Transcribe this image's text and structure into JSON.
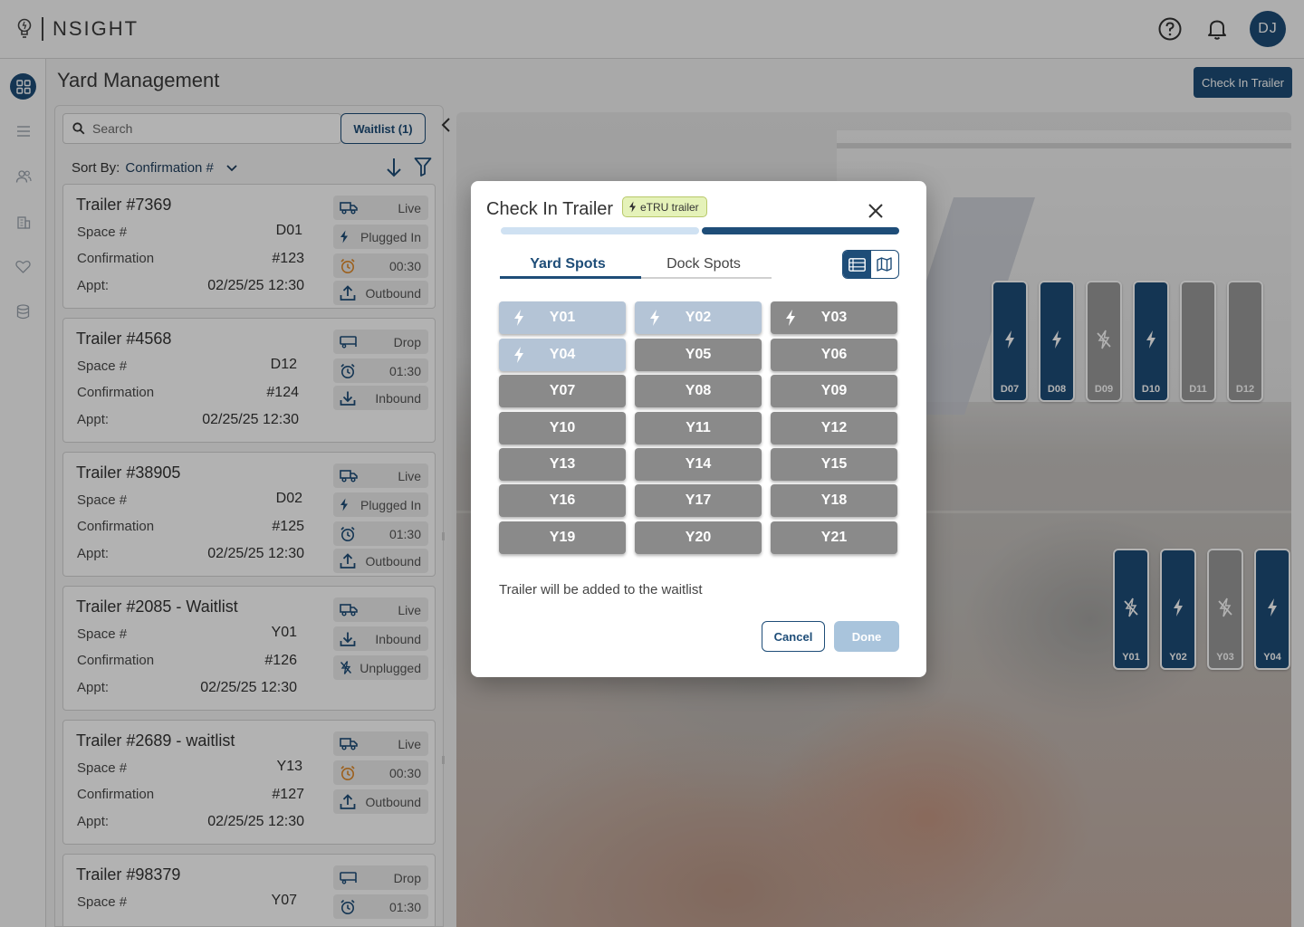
{
  "app": {
    "logo_text": "NSIGHT",
    "user_initials": "DJ"
  },
  "colors": {
    "brand": "#1e4d78",
    "spot_grey": "#8a8a8a",
    "spot_powered_light": "#b4c4d6",
    "etru_badge": "#e5f2b9",
    "timer_orange": "#e08a2a"
  },
  "header": {
    "title": "Yard Management",
    "check_in_label": "Check In Trailer"
  },
  "sidebar": {
    "items": [
      {
        "icon": "dashboard-grid-icon",
        "active": true
      },
      {
        "icon": "list-icon",
        "active": false
      },
      {
        "icon": "users-icon",
        "active": false
      },
      {
        "icon": "building-icon",
        "active": false
      },
      {
        "icon": "heart-icon",
        "active": false
      },
      {
        "icon": "database-icon",
        "active": false
      }
    ]
  },
  "list_panel": {
    "search_placeholder": "Search",
    "waitlist_label": "Waitlist (1)",
    "sort_label": "Sort By:",
    "sort_value": "Confirmation #",
    "labels": {
      "space": "Space #",
      "confirmation": "Confirmation",
      "appt": "Appt:"
    },
    "trailers": [
      {
        "title": "Trailer #7369",
        "space": "D01",
        "confirmation": "#123",
        "appt": "02/25/25 12:30",
        "chips": [
          {
            "icon": "truck-icon",
            "text": "Live"
          },
          {
            "icon": "bolt-icon",
            "text": "Plugged In"
          },
          {
            "icon": "alarm-clock-icon",
            "text": "00:30",
            "alert": true
          },
          {
            "icon": "upload-icon",
            "text": "Outbound"
          }
        ]
      },
      {
        "title": "Trailer #4568",
        "space": "D12",
        "confirmation": "#124",
        "appt": "02/25/25 12:30",
        "chips": [
          {
            "icon": "trailer-icon",
            "text": "Drop"
          },
          {
            "icon": "alarm-clock-icon",
            "text": "01:30"
          },
          {
            "icon": "download-icon",
            "text": "Inbound"
          }
        ]
      },
      {
        "title": "Trailer #38905",
        "space": "D02",
        "confirmation": "#125",
        "appt": "02/25/25 12:30",
        "chips": [
          {
            "icon": "truck-icon",
            "text": "Live"
          },
          {
            "icon": "bolt-icon",
            "text": "Plugged In"
          },
          {
            "icon": "alarm-clock-icon",
            "text": "01:30"
          },
          {
            "icon": "upload-icon",
            "text": "Outbound"
          }
        ]
      },
      {
        "title": "Trailer #2085 - Waitlist",
        "space": "Y01",
        "confirmation": "#126",
        "appt": "02/25/25 12:30",
        "chips": [
          {
            "icon": "truck-icon",
            "text": "Live"
          },
          {
            "icon": "download-icon",
            "text": "Inbound"
          },
          {
            "icon": "bolt-off-icon",
            "text": "Unplugged"
          }
        ]
      },
      {
        "title": "Trailer #2689 - waitlist",
        "space": "Y13",
        "confirmation": "#127",
        "appt": "02/25/25 12:30",
        "chips": [
          {
            "icon": "truck-icon",
            "text": "Live"
          },
          {
            "icon": "alarm-clock-icon",
            "text": "00:30",
            "alert": true
          },
          {
            "icon": "upload-icon",
            "text": "Outbound"
          }
        ]
      },
      {
        "title": "Trailer #98379",
        "space": "Y07",
        "confirmation": "",
        "appt": "",
        "chips": [
          {
            "icon": "trailer-icon",
            "text": "Drop"
          },
          {
            "icon": "alarm-clock-icon",
            "text": "01:30"
          }
        ]
      }
    ]
  },
  "map": {
    "dock_spots": [
      {
        "label": "D07",
        "status": "powered",
        "color": "blue"
      },
      {
        "label": "D08",
        "status": "powered",
        "color": "blue"
      },
      {
        "label": "D09",
        "status": "unpowered",
        "color": "grey"
      },
      {
        "label": "D10",
        "status": "powered",
        "color": "blue"
      },
      {
        "label": "D11",
        "status": "none",
        "color": "grey"
      },
      {
        "label": "D12",
        "status": "none",
        "color": "grey"
      }
    ],
    "yard_spots": [
      {
        "label": "Y01",
        "status": "unpowered",
        "color": "blue"
      },
      {
        "label": "Y02",
        "status": "powered",
        "color": "blue"
      },
      {
        "label": "Y03",
        "status": "unpowered",
        "color": "grey"
      },
      {
        "label": "Y04",
        "status": "powered",
        "color": "blue"
      }
    ]
  },
  "modal": {
    "title": "Check In Trailer",
    "badge": "eTRU trailer",
    "tabs": [
      "Yard Spots",
      "Dock Spots"
    ],
    "active_tab": "Yard Spots",
    "spots": [
      {
        "label": "Y01",
        "powered": true,
        "style": "light"
      },
      {
        "label": "Y02",
        "powered": true,
        "style": "light"
      },
      {
        "label": "Y03",
        "powered": true,
        "style": "grey"
      },
      {
        "label": "Y04",
        "powered": true,
        "style": "light"
      },
      {
        "label": "Y05"
      },
      {
        "label": "Y06"
      },
      {
        "label": "Y07"
      },
      {
        "label": "Y08"
      },
      {
        "label": "Y09"
      },
      {
        "label": "Y10"
      },
      {
        "label": "Y11"
      },
      {
        "label": "Y12"
      },
      {
        "label": "Y13"
      },
      {
        "label": "Y14"
      },
      {
        "label": "Y15"
      },
      {
        "label": "Y16"
      },
      {
        "label": "Y17"
      },
      {
        "label": "Y18"
      },
      {
        "label": "Y19"
      },
      {
        "label": "Y20"
      },
      {
        "label": "Y21"
      }
    ],
    "note": "Trailer will be added to the waitlist",
    "cancel_label": "Cancel",
    "done_label": "Done"
  }
}
